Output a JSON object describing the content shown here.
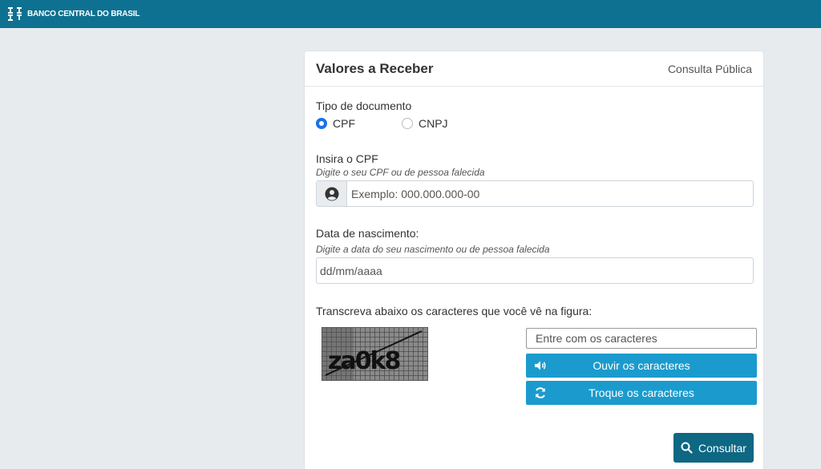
{
  "header": {
    "brand": "BANCO CENTRAL DO BRASIL"
  },
  "card": {
    "title": "Valores a Receber",
    "subtitle": "Consulta Pública"
  },
  "document_type": {
    "label": "Tipo de documento",
    "options": [
      {
        "label": "CPF",
        "selected": true
      },
      {
        "label": "CNPJ",
        "selected": false
      }
    ]
  },
  "cpf": {
    "label": "Insira o CPF",
    "hint": "Digite o seu CPF ou de pessoa falecida",
    "placeholder": "Exemplo: 000.000.000-00",
    "icon": "user-circle-icon"
  },
  "birthdate": {
    "label": "Data de nascimento:",
    "hint": "Digite a data do seu nascimento ou de pessoa falecida",
    "placeholder": "dd/mm/aaaa"
  },
  "captcha": {
    "label": "Transcreva abaixo os caracteres que você vê na figura:",
    "image_text": "za0k8",
    "input_placeholder": "Entre com os caracteres",
    "listen_label": "Ouvir os caracteres",
    "listen_icon": "speaker-icon",
    "refresh_label": "Troque os caracteres",
    "refresh_icon": "refresh-icon"
  },
  "submit": {
    "label": "Consultar",
    "icon": "search-icon"
  },
  "colors": {
    "header_bg": "#0e7191",
    "button_blue": "#1b9bcd",
    "submit_bg": "#0e6783",
    "radio_checked": "#1a73e8"
  }
}
